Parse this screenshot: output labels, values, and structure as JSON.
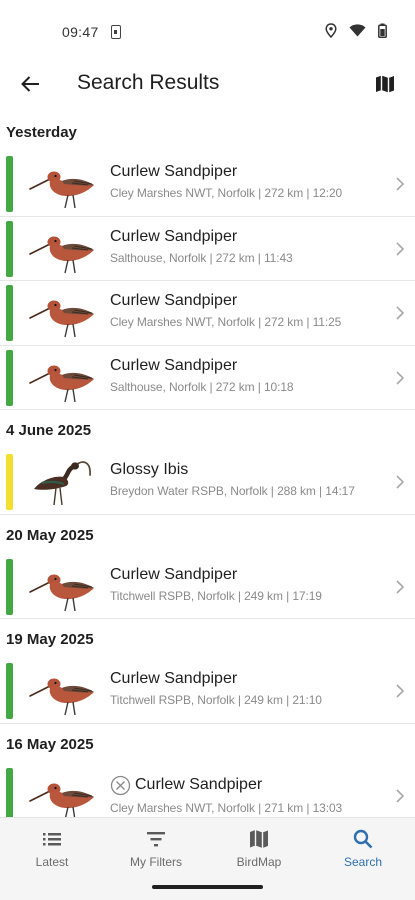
{
  "status_bar": {
    "time": "09:47"
  },
  "app_bar": {
    "title": "Search Results",
    "icons": [
      "back-arrow-icon",
      "map-icon"
    ]
  },
  "colors": {
    "common": "#43a843",
    "scarce": "#f2df2e",
    "accent": "#2f6fb0"
  },
  "groups": [
    {
      "date": "Yesterday",
      "items": [
        {
          "species": "Curlew Sandpiper",
          "details": "Cley Marshes NWT, Norfolk | 272 km | 12:20",
          "rarity": "common",
          "bird": "curlew-sandpiper"
        },
        {
          "species": "Curlew Sandpiper",
          "details": "Salthouse, Norfolk | 272 km | 11:43",
          "rarity": "common",
          "bird": "curlew-sandpiper"
        },
        {
          "species": "Curlew Sandpiper",
          "details": "Cley Marshes NWT, Norfolk | 272 km | 11:25",
          "rarity": "common",
          "bird": "curlew-sandpiper"
        },
        {
          "species": "Curlew Sandpiper",
          "details": "Salthouse, Norfolk | 272 km | 10:18",
          "rarity": "common",
          "bird": "curlew-sandpiper"
        }
      ]
    },
    {
      "date": "4 June 2025",
      "items": [
        {
          "species": "Glossy Ibis",
          "details": "Breydon Water RSPB, Norfolk | 288 km | 14:17",
          "rarity": "scarce",
          "bird": "glossy-ibis"
        }
      ]
    },
    {
      "date": "20 May 2025",
      "items": [
        {
          "species": "Curlew Sandpiper",
          "details": "Titchwell RSPB, Norfolk | 249 km | 17:19",
          "rarity": "common",
          "bird": "curlew-sandpiper"
        }
      ]
    },
    {
      "date": "19 May 2025",
      "items": [
        {
          "species": "Curlew Sandpiper",
          "details": "Titchwell RSPB, Norfolk | 249 km | 21:10",
          "rarity": "common",
          "bird": "curlew-sandpiper"
        }
      ]
    },
    {
      "date": "16 May 2025",
      "items": [
        {
          "species": "Curlew Sandpiper",
          "details": "Cley Marshes NWT, Norfolk | 271 km | 13:03",
          "rarity": "common",
          "bird": "curlew-sandpiper",
          "status_icon": "cancelled-icon"
        }
      ]
    }
  ],
  "bottom_nav": [
    {
      "label": "Latest",
      "icon": "list-icon",
      "active": false
    },
    {
      "label": "My Filters",
      "icon": "filter-icon",
      "active": false
    },
    {
      "label": "BirdMap",
      "icon": "map-icon",
      "active": false
    },
    {
      "label": "Search",
      "icon": "search-icon",
      "active": true
    }
  ]
}
